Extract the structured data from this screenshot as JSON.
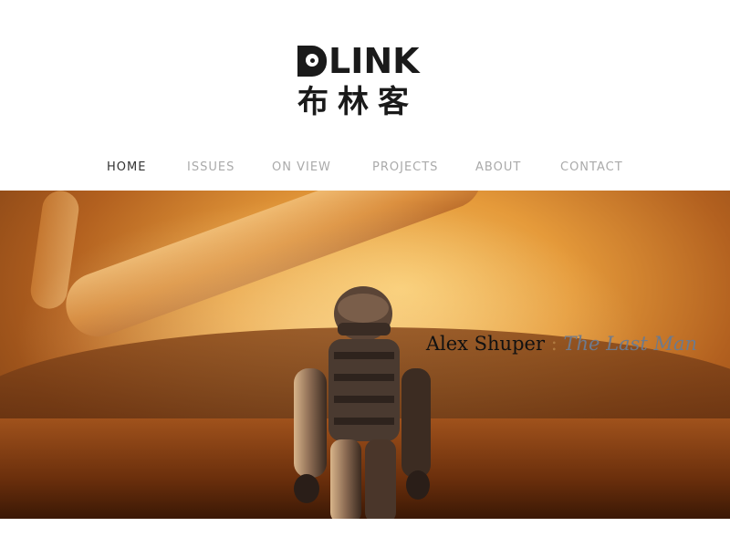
{
  "logo": {
    "latin": "LINK",
    "chinese": "布林客"
  },
  "nav": {
    "items": [
      {
        "label": "HOME",
        "active": true
      },
      {
        "label": "ISSUES",
        "active": false
      },
      {
        "label": "ON VIEW",
        "active": false
      },
      {
        "label": "PROJECTS",
        "active": false
      },
      {
        "label": "ABOUT",
        "active": false
      },
      {
        "label": "CONTACT",
        "active": false
      }
    ]
  },
  "hero": {
    "artist": "Alex Shuper",
    "separator": ":",
    "title": "The Last Man"
  },
  "colors": {
    "nav_active": "#333333",
    "nav_inactive": "#aaaaaa",
    "caption_artist": "#111111",
    "caption_title": "#6e7a8c"
  }
}
